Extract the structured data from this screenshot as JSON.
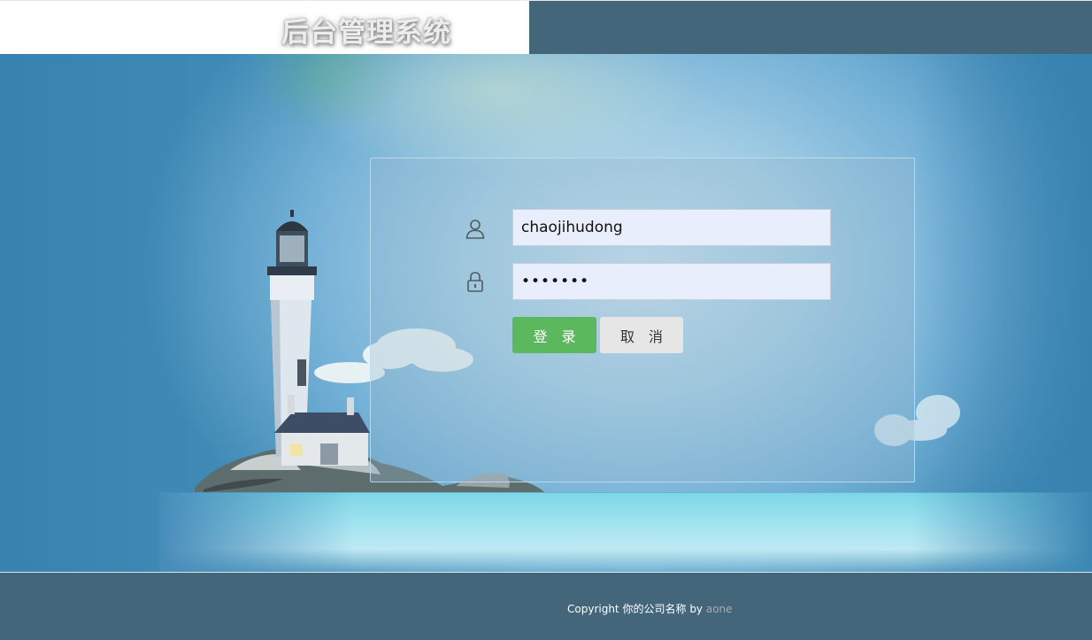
{
  "header": {
    "title": "后台管理系统"
  },
  "login_form": {
    "username_value": "chaojihudong",
    "password_value": "•••••••",
    "login_button_label": "登　录",
    "cancel_button_label": "取　消"
  },
  "footer": {
    "copyright_prefix": "Copyright",
    "company_name": "你的公司名称",
    "by_label": "by",
    "author_link": "aone"
  },
  "icons": {
    "username": "user-icon",
    "password": "lock-icon"
  },
  "colors": {
    "header_bg": "#43667a",
    "login_button": "#5cb85c",
    "cancel_button": "#e6e6e6",
    "input_bg": "#e8eefb",
    "author_link": "#a9a9a9"
  }
}
